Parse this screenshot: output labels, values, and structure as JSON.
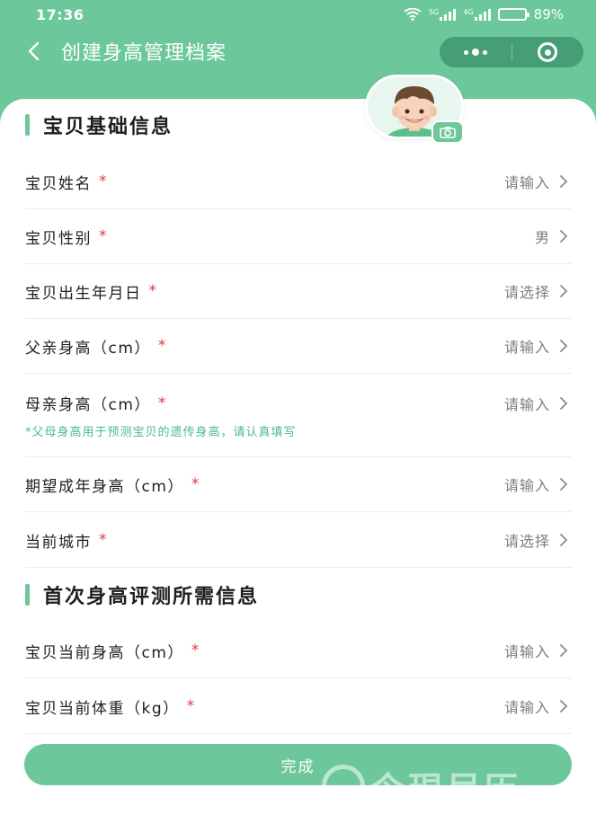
{
  "status_bar": {
    "time": "17:36",
    "network_1": "5G",
    "network_2": "4G",
    "battery": "89%",
    "battery_level": 0.89
  },
  "header": {
    "title": "创建身高管理档案",
    "back_icon": "back-chevron-icon",
    "more_icon": "more-dots-icon",
    "close_icon": "target-circle-icon"
  },
  "avatar": {
    "icon": "boy-avatar",
    "camera_icon": "camera-icon"
  },
  "sections": [
    {
      "title": "宝贝基础信息",
      "rows": [
        {
          "label": "宝贝姓名",
          "required": "*",
          "value": "请输入"
        },
        {
          "label": "宝贝性别",
          "required": "*",
          "value": "男"
        },
        {
          "label": "宝贝出生年月日",
          "required": "*",
          "value": "请选择"
        },
        {
          "label": "父亲身高（cm）",
          "required": "*",
          "value": "请输入"
        },
        {
          "label": "母亲身高（cm）",
          "required": "*",
          "value": "请输入"
        },
        {
          "label": "期望成年身高（cm）",
          "required": "*",
          "value": "请输入"
        },
        {
          "label": "当前城市",
          "required": "*",
          "value": "请选择"
        }
      ],
      "hint": "*父母身高用于预测宝贝的遗传身高，请认真填写"
    },
    {
      "title": "首次身高评测所需信息",
      "rows": [
        {
          "label": "宝贝当前身高（cm）",
          "required": "*",
          "value": "请输入"
        },
        {
          "label": "宝贝当前体重（kg）",
          "required": "*",
          "value": "请输入"
        }
      ]
    }
  ],
  "done_button": "完成",
  "watermark": "今現尽历",
  "colors": {
    "brand": "#6cc79a",
    "required": "#e0393e",
    "hint": "#4bbb86"
  }
}
